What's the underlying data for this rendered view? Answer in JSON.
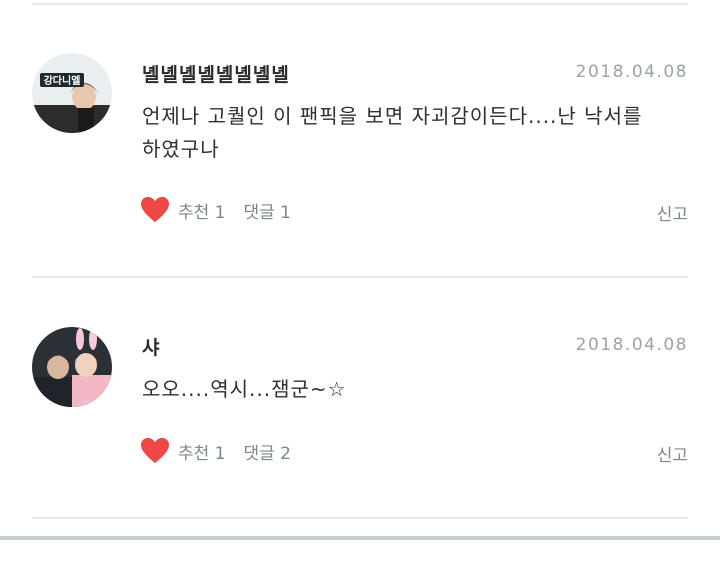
{
  "comments": [
    {
      "author": "녤녤녤녤녤녤녤녤",
      "date": "2018.04.08",
      "text": "언제나 고퀄인 이 팬픽을 보면 자괴감이든다....난 낙서를 하였구나",
      "avatar_banner": "강다니엘",
      "like_label": "추천 1",
      "reply_label": "댓글 1",
      "report_label": "신고",
      "heart_icon": "heart-icon"
    },
    {
      "author": "샤",
      "date": "2018.04.08",
      "text": "오오....역시...잼군~☆",
      "like_label": "추천 1",
      "reply_label": "댓글 2",
      "report_label": "신고",
      "heart_icon": "heart-icon"
    }
  ],
  "colors": {
    "heart": "#ef4646",
    "divider": "#e3e8ea",
    "meta": "#9aa4a8"
  }
}
